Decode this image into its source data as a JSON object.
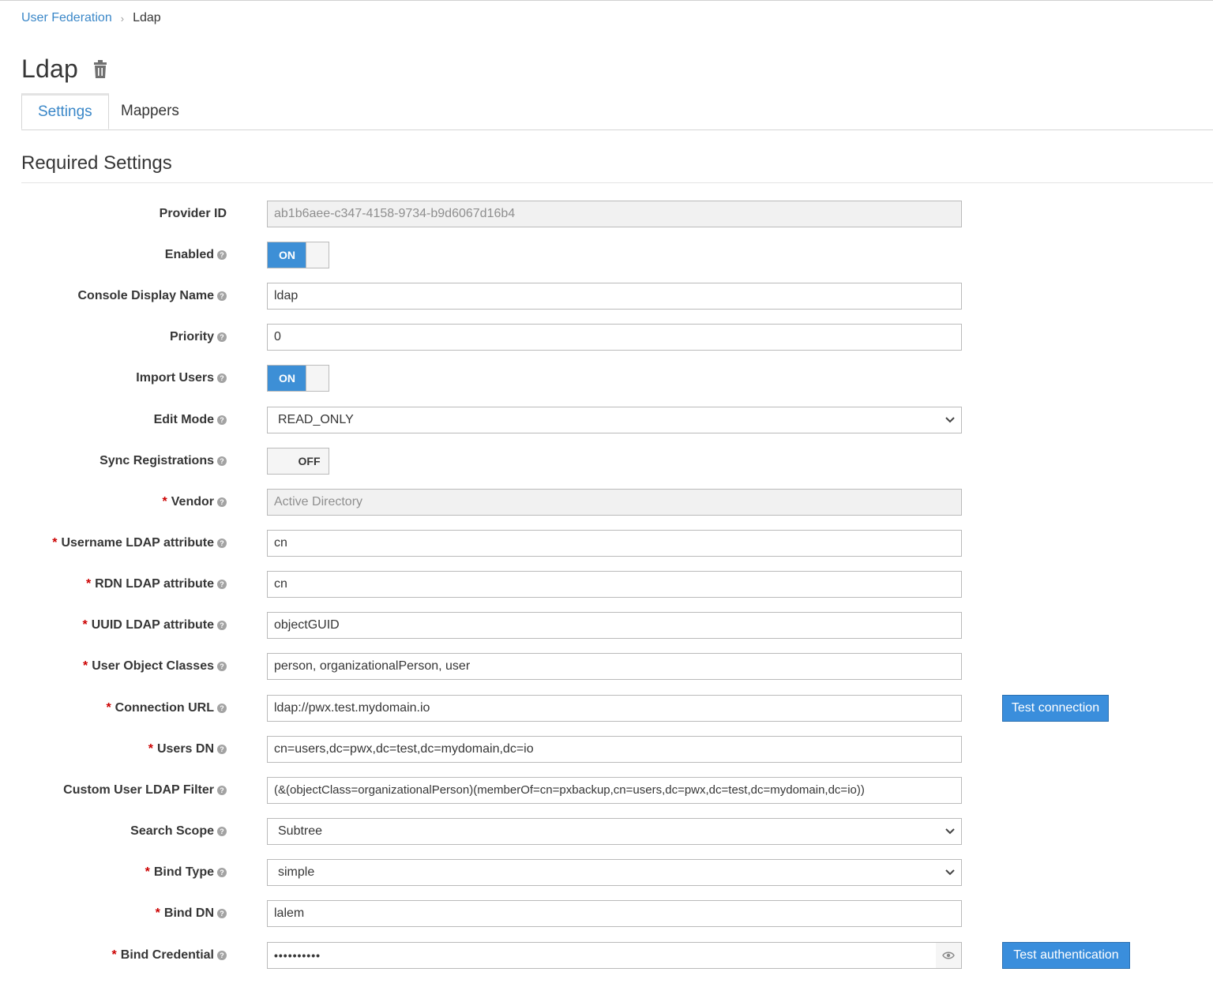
{
  "breadcrumb": {
    "parent": "User Federation",
    "separator": "›",
    "current": "Ldap"
  },
  "page": {
    "title": "Ldap"
  },
  "tabs": {
    "settings": "Settings",
    "mappers": "Mappers"
  },
  "section": {
    "title": "Required Settings"
  },
  "help_glyph": "?",
  "required_mark": "*",
  "fields": {
    "provider_id": {
      "label": "Provider ID",
      "value": "ab1b6aee-c347-4158-9734-b9d6067d16b4"
    },
    "enabled": {
      "label": "Enabled",
      "state": "ON"
    },
    "console_display_name": {
      "label": "Console Display Name",
      "value": "ldap"
    },
    "priority": {
      "label": "Priority",
      "value": "0"
    },
    "import_users": {
      "label": "Import Users",
      "state": "ON"
    },
    "edit_mode": {
      "label": "Edit Mode",
      "value": "READ_ONLY"
    },
    "sync_registrations": {
      "label": "Sync Registrations",
      "state": "OFF"
    },
    "vendor": {
      "label": "Vendor",
      "value": "Active Directory"
    },
    "username_ldap_attribute": {
      "label": "Username LDAP attribute",
      "value": "cn"
    },
    "rdn_ldap_attribute": {
      "label": "RDN LDAP attribute",
      "value": "cn"
    },
    "uuid_ldap_attribute": {
      "label": "UUID LDAP attribute",
      "value": "objectGUID"
    },
    "user_object_classes": {
      "label": "User Object Classes",
      "value": "person, organizationalPerson, user"
    },
    "connection_url": {
      "label": "Connection URL",
      "value": "ldap://pwx.test.mydomain.io"
    },
    "users_dn": {
      "label": "Users DN",
      "value": "cn=users,dc=pwx,dc=test,dc=mydomain,dc=io"
    },
    "custom_user_ldap_filter": {
      "label": "Custom User LDAP Filter",
      "value": "(&(objectClass=organizationalPerson)(memberOf=cn=pxbackup,cn=users,dc=pwx,dc=test,dc=mydomain,dc=io))"
    },
    "search_scope": {
      "label": "Search Scope",
      "value": "Subtree"
    },
    "bind_type": {
      "label": "Bind Type",
      "value": "simple"
    },
    "bind_dn": {
      "label": "Bind DN",
      "value": "lalem"
    },
    "bind_credential": {
      "label": "Bind Credential",
      "value": "••••••••••"
    }
  },
  "buttons": {
    "test_connection": "Test connection",
    "test_authentication": "Test authentication"
  },
  "icons": {
    "delete": "trash-icon",
    "help": "question-circle-icon",
    "dropdown": "chevron-down-icon",
    "reveal": "eye-icon"
  },
  "colors": {
    "accent": "#3a87c8",
    "toggle_on": "#3d8fd6",
    "button": "#3a8edc",
    "required": "#cc0000"
  }
}
